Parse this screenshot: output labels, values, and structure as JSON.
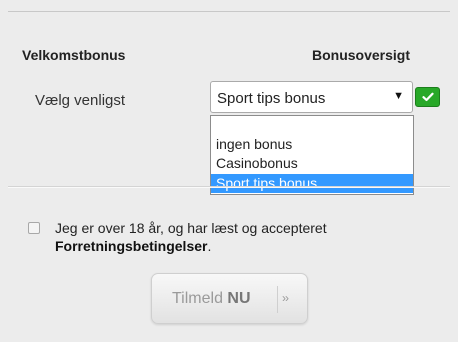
{
  "form": {
    "welcome_bonus_heading": "Velkomstbonus",
    "bonus_overview_link": "Bonusoversigt",
    "select_label": "Vælg venligst",
    "selected_value": "Sport tips bonus",
    "options": [
      "",
      "ingen bonus",
      "Casinobonus",
      "Sport tips bonus"
    ]
  },
  "terms": {
    "text": "Jeg er over 18 år, og har læst og accepteret",
    "link": "Forretningsbetingelser",
    "suffix": "."
  },
  "submit": {
    "label_prefix": "Tilmeld",
    "label_bold": "NU",
    "arrow": "››"
  },
  "colors": {
    "background": "#ececec",
    "selected_option": "#3399ff",
    "confirm_badge": "#28a828"
  },
  "icons": {
    "select_arrow": "triangle-down",
    "confirm": "checkmark"
  }
}
